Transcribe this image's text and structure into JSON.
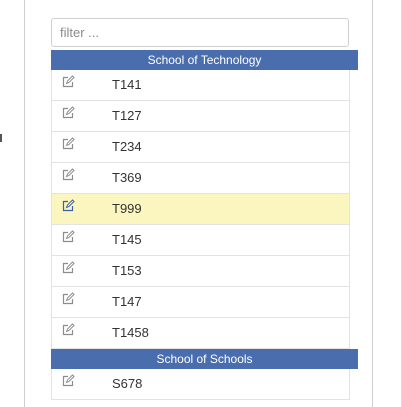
{
  "filter": {
    "placeholder": "filter ..."
  },
  "groups": [
    {
      "title": "School of Technology",
      "rows": [
        {
          "code": "T141"
        },
        {
          "code": "T127"
        },
        {
          "code": "T234"
        },
        {
          "code": "T369"
        },
        {
          "code": "T999",
          "selected": true
        },
        {
          "code": "T145"
        },
        {
          "code": "T153"
        },
        {
          "code": "T147"
        },
        {
          "code": "T1458"
        }
      ]
    },
    {
      "title": "School of Schools",
      "rows": [
        {
          "code": "S678"
        }
      ]
    }
  ],
  "colors": {
    "header_bg": "#4a6ead",
    "selected_bg": "#fbf5c0",
    "icon_color": "#8c8c8c",
    "icon_color_selected": "#3b5fa8"
  },
  "icons": {
    "row_action": "edit-icon"
  }
}
